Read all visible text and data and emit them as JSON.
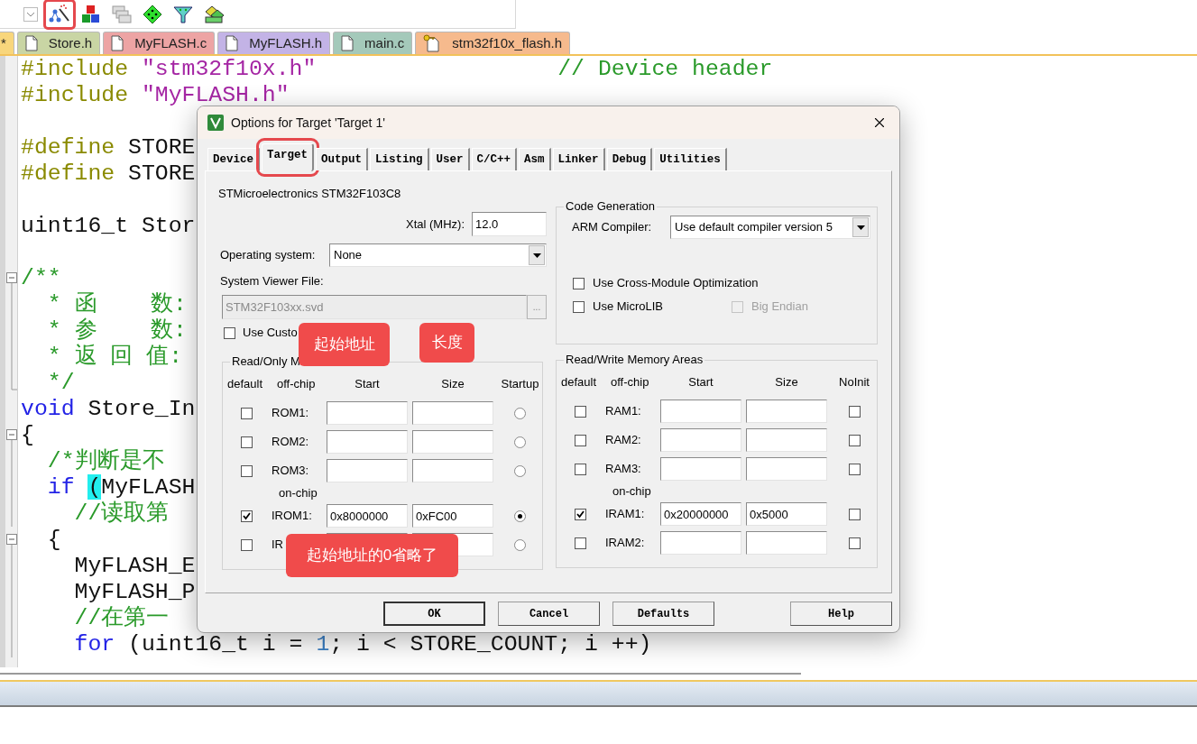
{
  "toolbar": {
    "items": [
      {
        "kind": "dropdown",
        "highlighted": false
      },
      {
        "kind": "wand",
        "highlighted": true
      },
      {
        "kind": "blocks",
        "highlighted": false
      },
      {
        "kind": "windows",
        "highlighted": false
      },
      {
        "kind": "diamond",
        "highlighted": false
      },
      {
        "kind": "funnel",
        "highlighted": false
      },
      {
        "kind": "tiles",
        "highlighted": false
      }
    ]
  },
  "file_tabs": [
    {
      "label": "*",
      "color": "#f8d67c",
      "kind": "plain"
    },
    {
      "label": "Store.h",
      "color": "#c9d5a4",
      "kind": "file"
    },
    {
      "label": "MyFLASH.c",
      "color": "#eda4a4",
      "kind": "file"
    },
    {
      "label": "MyFLASH.h",
      "color": "#c3b3e6",
      "kind": "file"
    },
    {
      "label": "main.c",
      "color": "#a4c9ba",
      "kind": "file"
    },
    {
      "label": "stm32f10x_flash.h",
      "color": "#f6ba8d",
      "kind": "locked"
    }
  ],
  "code_lines": [
    {
      "kind": "plain",
      "segments": [
        {
          "kind": "directive",
          "text": "#include "
        },
        {
          "kind": "string",
          "text": "\"stm32f10x.h\""
        },
        {
          "kind": "comment",
          "text": "                  // Device header"
        }
      ]
    },
    {
      "kind": "plain",
      "segments": [
        {
          "kind": "directive",
          "text": "#include "
        },
        {
          "kind": "string",
          "text": "\"MyFLASH.h\""
        }
      ]
    },
    {
      "kind": "plain"
    },
    {
      "kind": "plain",
      "segments": [
        {
          "kind": "directive",
          "text": "#define "
        },
        {
          "kind": "plain",
          "text": "STORE"
        }
      ]
    },
    {
      "kind": "plain",
      "segments": [
        {
          "kind": "directive",
          "text": "#define "
        },
        {
          "kind": "plain",
          "text": "STORE"
        }
      ]
    },
    {
      "kind": "plain"
    },
    {
      "kind": "plain",
      "segments": [
        {
          "kind": "plain",
          "text": "uint16_t Stor"
        }
      ]
    },
    {
      "kind": "plain"
    },
    {
      "kind": "fold-start",
      "segments": [
        {
          "kind": "comment",
          "text": "/**"
        }
      ]
    },
    {
      "kind": "fold-inner",
      "segments": [
        {
          "kind": "comment",
          "text": "  * 函    数:"
        }
      ]
    },
    {
      "kind": "fold-inner",
      "segments": [
        {
          "kind": "comment",
          "text": "  * 参    数:"
        }
      ]
    },
    {
      "kind": "fold-inner",
      "segments": [
        {
          "kind": "comment",
          "text": "  * 返 回 值:"
        }
      ]
    },
    {
      "kind": "fold-end",
      "segments": [
        {
          "kind": "comment",
          "text": "  */"
        }
      ]
    },
    {
      "kind": "plain",
      "segments": [
        {
          "kind": "keyword",
          "text": "void"
        },
        {
          "kind": "plain",
          "text": " Store_In"
        }
      ]
    },
    {
      "kind": "fold-start",
      "segments": [
        {
          "kind": "plain",
          "text": "{"
        }
      ]
    },
    {
      "kind": "fold-inner",
      "segments": [
        {
          "kind": "comment",
          "text": "  /*判断是不"
        }
      ]
    },
    {
      "kind": "fold-inner",
      "segments": [
        {
          "kind": "keyword",
          "text": "  if "
        },
        {
          "kind": "match",
          "text": "("
        },
        {
          "kind": "plain",
          "text": "MyFLASH"
        }
      ]
    },
    {
      "kind": "fold-inner",
      "segments": [
        {
          "kind": "comment",
          "text": "    //读取第"
        }
      ]
    },
    {
      "kind": "fold-start",
      "segments": [
        {
          "kind": "plain",
          "text": "  {"
        }
      ]
    },
    {
      "kind": "fold-inner",
      "segments": [
        {
          "kind": "plain",
          "text": "    MyFLASH_E"
        }
      ]
    },
    {
      "kind": "fold-inner",
      "segments": [
        {
          "kind": "plain",
          "text": "    MyFLASH_P"
        }
      ]
    },
    {
      "kind": "fold-inner",
      "segments": [
        {
          "kind": "comment",
          "text": "    //在第一"
        }
      ]
    },
    {
      "kind": "fold-inner",
      "segments": [
        {
          "kind": "keyword",
          "text": "    for"
        },
        {
          "kind": "plain",
          "text": " (uint16_t i = "
        },
        {
          "kind": "number",
          "text": "1"
        },
        {
          "kind": "plain",
          "text": "; i < STORE_COUNT; i ++)"
        }
      ]
    }
  ],
  "dialog": {
    "title": "Options for Target 'Target 1'",
    "tabs": [
      {
        "label": "Device",
        "selected": false,
        "highlighted": false
      },
      {
        "label": "Target",
        "selected": true,
        "highlighted": true
      },
      {
        "label": "Output",
        "selected": false,
        "highlighted": false
      },
      {
        "label": "Listing",
        "selected": false,
        "highlighted": false
      },
      {
        "label": "User",
        "selected": false,
        "highlighted": false
      },
      {
        "label": "C/C++",
        "selected": false,
        "highlighted": false
      },
      {
        "label": "Asm",
        "selected": false,
        "highlighted": false
      },
      {
        "label": "Linker",
        "selected": false,
        "highlighted": false
      },
      {
        "label": "Debug",
        "selected": false,
        "highlighted": false
      },
      {
        "label": "Utilities",
        "selected": false,
        "highlighted": false
      }
    ],
    "device": "STMicroelectronics STM32F103C8",
    "xtal": {
      "label": "Xtal (MHz):",
      "value": "12.0"
    },
    "operating_system": {
      "label": "Operating system:",
      "value": "None"
    },
    "system_viewer_file": {
      "label": "System Viewer File:",
      "value": "STM32F103xx.svd",
      "disabled": true,
      "browse": "..."
    },
    "use_custom": {
      "label": "Use Custo",
      "checked": false
    },
    "rom": {
      "kind": "rom",
      "title": "Read/Only M",
      "headers": [
        "default",
        "off-chip",
        "Start",
        "Size",
        "Startup"
      ],
      "rows": [
        {
          "kind": "row",
          "label": "ROM1:",
          "default": false,
          "startup": false
        },
        {
          "kind": "row",
          "label": "ROM2:",
          "default": false,
          "startup": false
        },
        {
          "kind": "row",
          "label": "ROM3:",
          "default": false,
          "startup": false
        },
        {
          "kind": "heading",
          "label": "on-chip"
        },
        {
          "kind": "row",
          "label": "IROM1:",
          "start": "0x8000000",
          "size": "0xFC00",
          "default": true,
          "startup": true
        },
        {
          "kind": "row",
          "label": "IR",
          "default": false,
          "startup": false
        }
      ]
    },
    "code_generation": {
      "title": "Code Generation",
      "compiler": {
        "label": "ARM Compiler:",
        "value": "Use default compiler version 5"
      },
      "options": [
        {
          "label": "Use Cross-Module Optimization",
          "checked": false,
          "disabled": false
        },
        {
          "label": "Use MicroLIB",
          "checked": false,
          "disabled": false
        },
        {
          "label": "Big Endian",
          "checked": false,
          "disabled": true
        }
      ]
    },
    "ram": {
      "kind": "ram",
      "title": "Read/Write Memory Areas",
      "headers": [
        "default",
        "off-chip",
        "Start",
        "Size",
        "NoInit"
      ],
      "rows": [
        {
          "kind": "row",
          "label": "RAM1:",
          "default": false,
          "noinit": false
        },
        {
          "kind": "row",
          "label": "RAM2:",
          "default": false,
          "noinit": false
        },
        {
          "kind": "row",
          "label": "RAM3:",
          "default": false,
          "noinit": false
        },
        {
          "kind": "heading",
          "label": "on-chip"
        },
        {
          "kind": "row",
          "label": "IRAM1:",
          "start": "0x20000000",
          "size": "0x5000",
          "default": true,
          "noinit": false
        },
        {
          "kind": "row",
          "label": "IRAM2:",
          "default": false,
          "noinit": false
        }
      ]
    },
    "buttons": [
      {
        "label": "OK",
        "default": true
      },
      {
        "label": "Cancel",
        "default": false
      },
      {
        "label": "Defaults",
        "default": false
      },
      {
        "label": "Help",
        "default": false
      }
    ]
  },
  "callouts": [
    {
      "text": "起始地址"
    },
    {
      "text": "长度"
    },
    {
      "text": "起始地址的0省略了"
    }
  ]
}
